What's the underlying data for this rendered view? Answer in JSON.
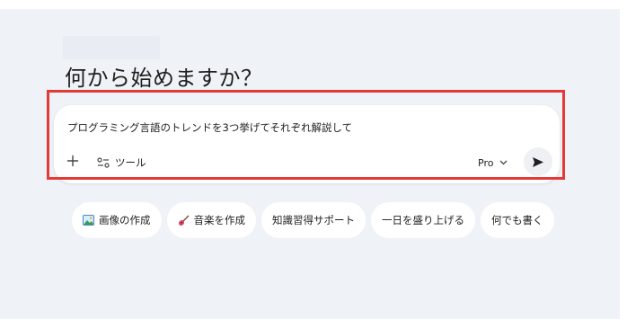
{
  "heading": "何から始めますか？",
  "prompt": {
    "text": "プログラミング言語のトレンドを3つ挙げてそれぞれ解説して",
    "add_icon": "plus-icon",
    "tools_icon": "tools-icon",
    "tools_label": "ツール",
    "model_label": "Pro",
    "model_icon": "chevron-down-icon",
    "send_icon": "send-icon"
  },
  "suggestions": [
    {
      "icon": "image-icon",
      "label": "画像の作成"
    },
    {
      "icon": "guitar-icon",
      "label": "音楽を作成"
    },
    {
      "icon": "",
      "label": "知識習得サポート"
    },
    {
      "icon": "",
      "label": "一日を盛り上げる"
    },
    {
      "icon": "",
      "label": "何でも書く"
    }
  ],
  "colors": {
    "background": "#eff2f7",
    "card": "#ffffff",
    "highlight_border": "#e53935",
    "text": "#1f1f1f"
  }
}
